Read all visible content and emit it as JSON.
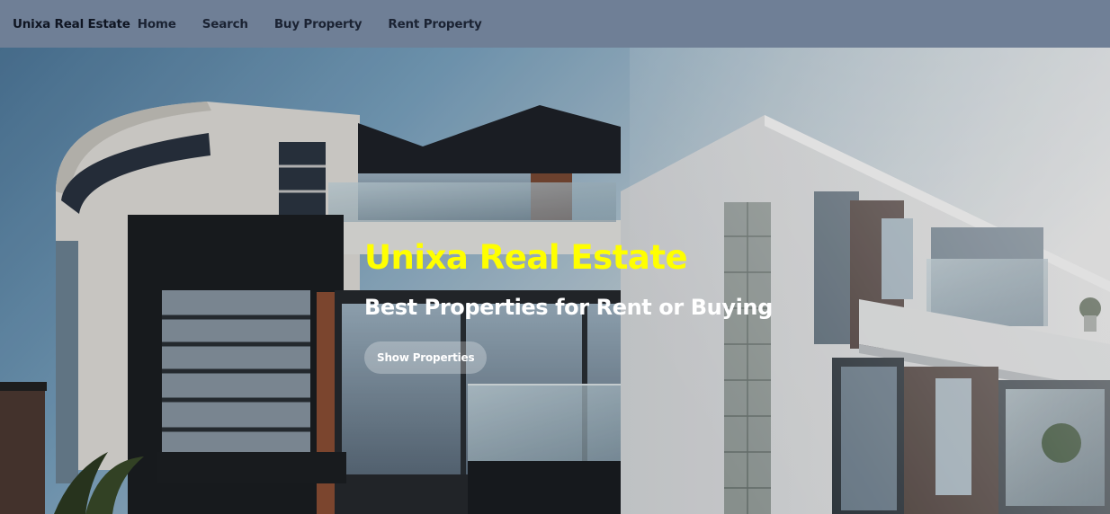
{
  "navbar": {
    "brand": "Unixa Real Estate",
    "links": [
      "Home",
      "Search",
      "Buy Property",
      "Rent Property"
    ]
  },
  "hero": {
    "title": "Unixa Real Estate",
    "subtitle": "Best Properties for Rent or Buying",
    "button_label": "Show Properties"
  },
  "colors": {
    "navbar_bg": "#6f7f96",
    "title_color": "#ffff00",
    "subtitle_color": "#ffffff"
  }
}
